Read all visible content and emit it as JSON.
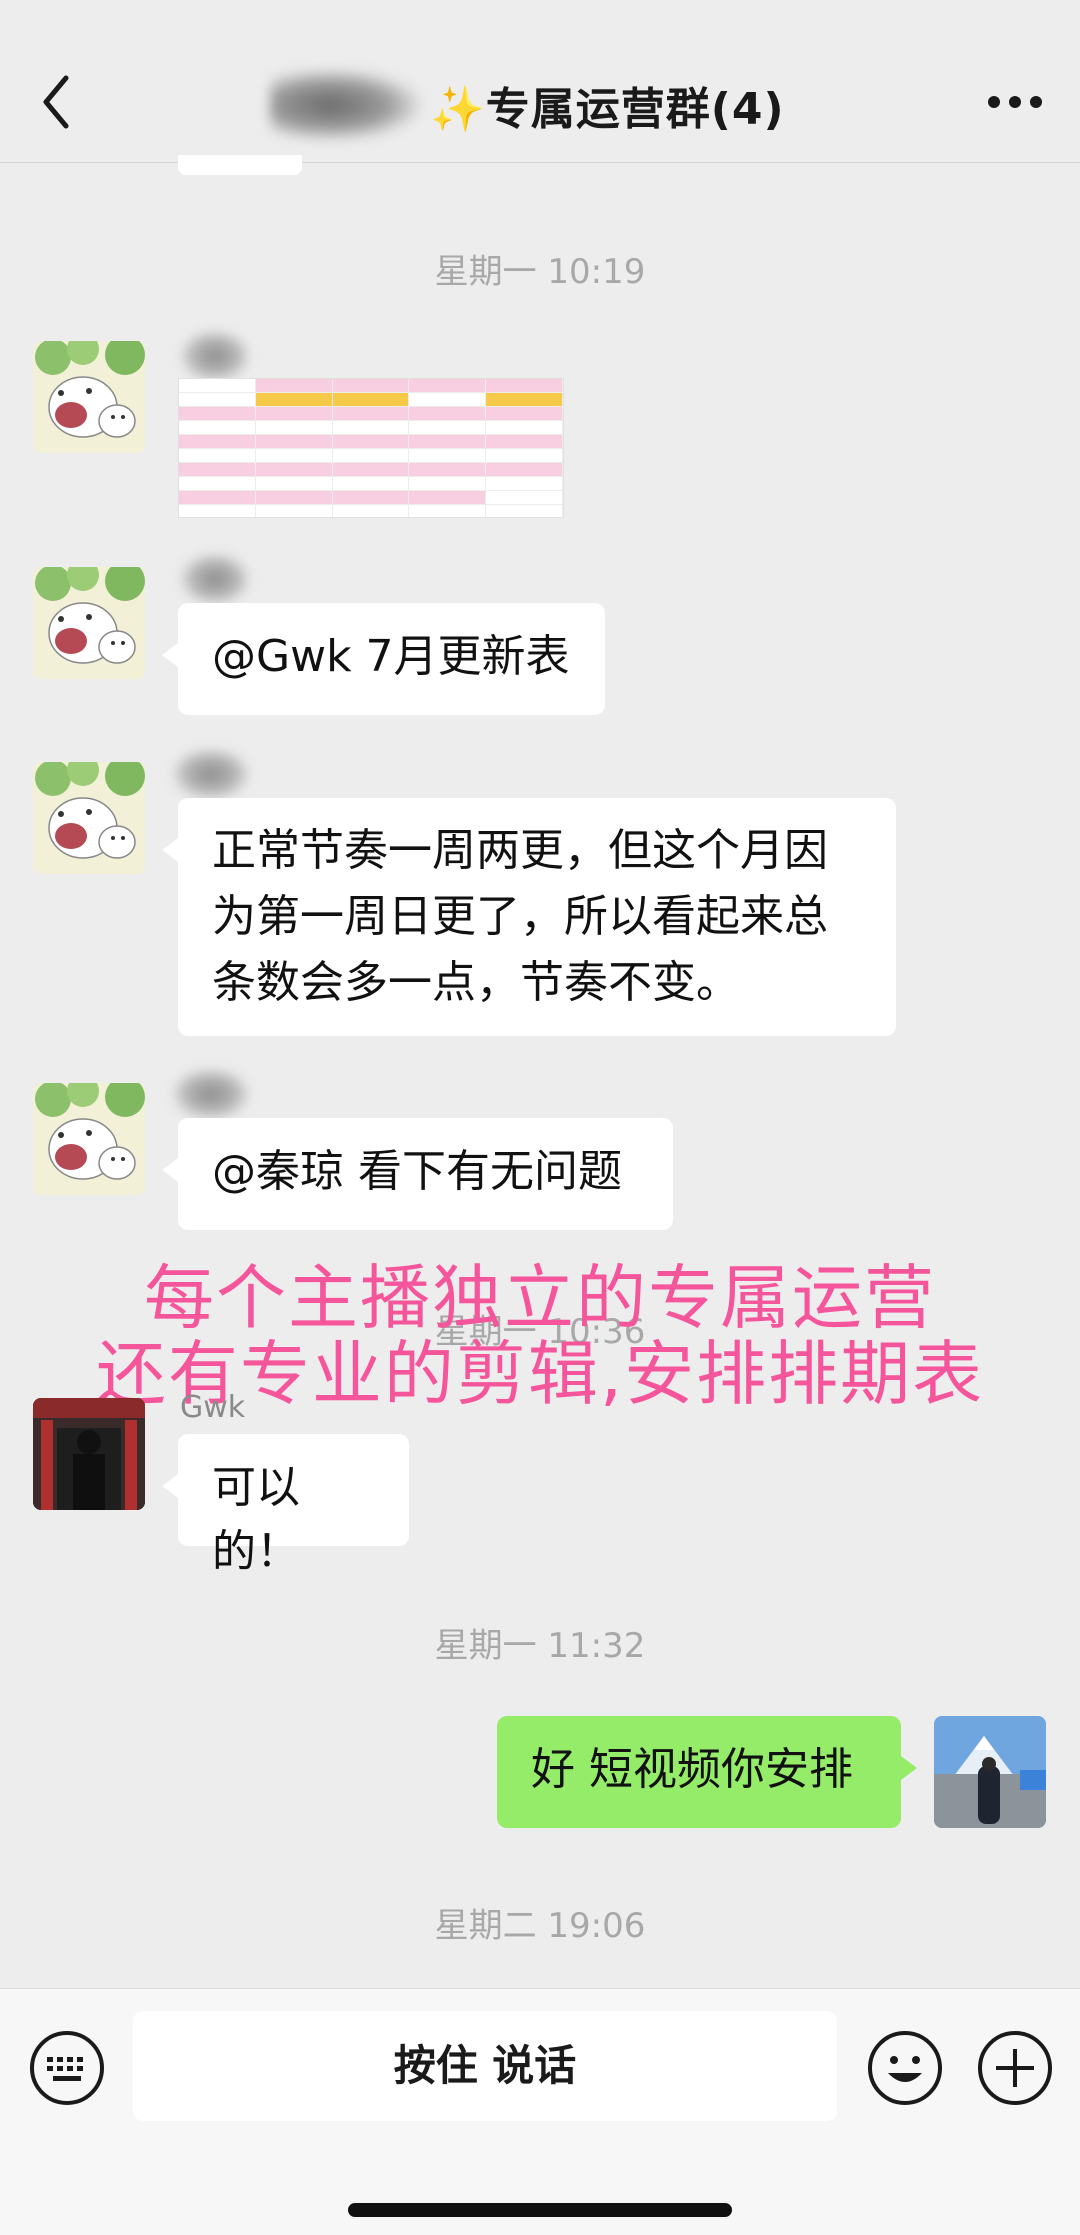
{
  "header": {
    "title": "✨专属运营群(4)",
    "back_icon": "chevron-left-icon",
    "more_icon": "more-dots-icon"
  },
  "timestamps": {
    "t1": "星期一 10:19",
    "t2": "星期一 10:36",
    "t3": "星期一 11:32",
    "t4": "星期二 19:06"
  },
  "messages": {
    "m2": "@Gwk 7月更新表",
    "m3": "正常节奏一周两更，但这个月因为第一周日更了，所以看起来总条数会多一点，节奏不变。",
    "m4": "@秦琼 看下有无问题",
    "m5_sender": "Gwk",
    "m5": "可以的！",
    "m6": "好 短视频你安排"
  },
  "overlay": {
    "line1": "每个主播独立的专属运营",
    "line2": "还有专业的剪辑,安排排期表"
  },
  "input_bar": {
    "voice_label": "按住 说话",
    "keyboard_icon": "keyboard-icon",
    "emoji_icon": "emoji-icon",
    "plus_icon": "plus-circle-icon"
  },
  "colors": {
    "accent_bubble": "#95ec69",
    "overlay_text": "#f5559b",
    "background": "#ededed"
  }
}
